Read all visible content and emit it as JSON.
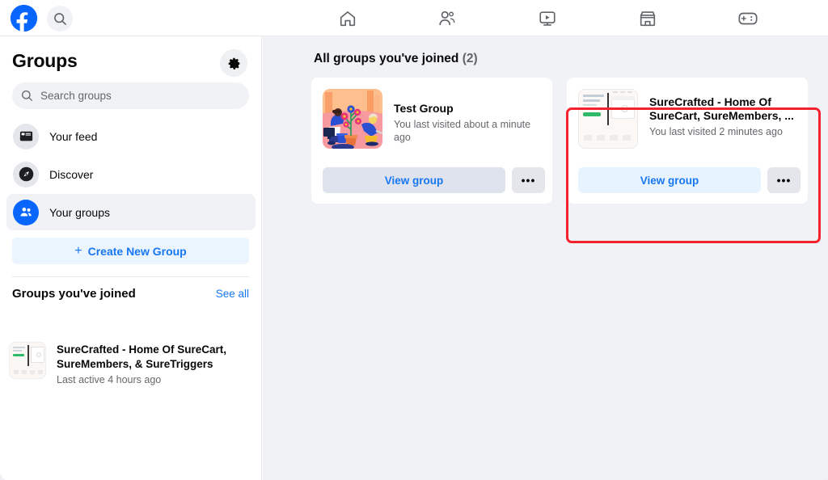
{
  "topbar": {
    "logo": "facebook-logo",
    "search_icon": "search-icon",
    "nav": [
      {
        "name": "home",
        "icon": "home-icon",
        "label": "Home"
      },
      {
        "name": "friends",
        "icon": "friends-icon",
        "label": "Friends"
      },
      {
        "name": "video",
        "icon": "video-icon",
        "label": "Video"
      },
      {
        "name": "marketplace",
        "icon": "marketplace-icon",
        "label": "Marketplace"
      },
      {
        "name": "gaming",
        "icon": "gaming-icon",
        "label": "Gaming"
      }
    ]
  },
  "sidebar": {
    "title": "Groups",
    "settings_icon": "gear-icon",
    "search": {
      "placeholder": "Search groups",
      "value": "",
      "icon": "search-icon"
    },
    "nav_items": [
      {
        "label": "Your feed",
        "icon": "feed-icon",
        "active": false
      },
      {
        "label": "Discover",
        "icon": "compass-icon",
        "active": false
      },
      {
        "label": "Your groups",
        "icon": "groups-icon",
        "active": true
      }
    ],
    "create_button": {
      "plus": "+",
      "label": "Create New Group"
    },
    "joined_section": {
      "title": "Groups you've joined",
      "see_all": "See all",
      "items": [
        {
          "name": "SureCrafted - Home Of SureCart, SureMembers, & SureTriggers",
          "subtitle": "Last active 4 hours ago",
          "thumb": "surecrafted-thumbnail"
        }
      ]
    }
  },
  "main": {
    "heading_text": "All groups you've joined",
    "heading_count": "(2)",
    "cards": [
      {
        "name": "Test Group",
        "subtitle": "You last visited about a minute ago",
        "view_label": "View group",
        "more_label": "•••",
        "thumb": "garden-illustration-thumbnail",
        "highlighted": true
      },
      {
        "name": "SureCrafted - Home Of SureCart, SureMembers, ...",
        "subtitle": "You last visited 2 minutes ago",
        "view_label": "View group",
        "more_label": "•••",
        "thumb": "surecrafted-thumbnail",
        "highlighted": false
      }
    ]
  },
  "colors": {
    "brand_blue": "#1877f2",
    "logo_blue": "#0866ff",
    "highlight_red": "#f5222d",
    "page_bg": "#f0f2f5",
    "text_primary": "#080809",
    "text_secondary": "#65676b"
  }
}
